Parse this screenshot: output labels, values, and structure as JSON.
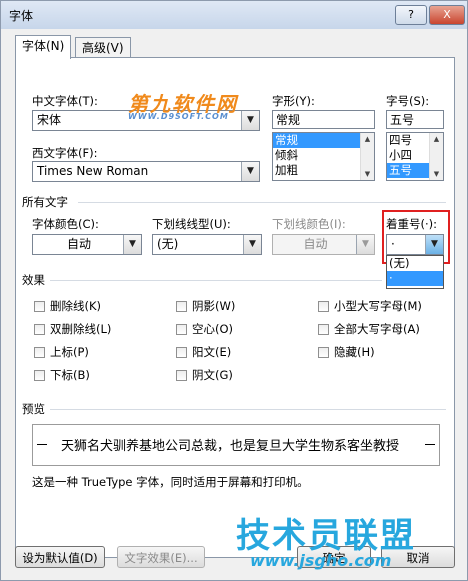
{
  "window": {
    "title": "字体",
    "help_button": "?",
    "close_button": "X"
  },
  "tabs": [
    {
      "label": "字体(N)",
      "active": true
    },
    {
      "label": "高级(V)",
      "active": false
    }
  ],
  "chinese_font": {
    "label": "中文字体(T):",
    "value": "宋体"
  },
  "western_font": {
    "label": "西文字体(F):",
    "value": "Times New Roman"
  },
  "style": {
    "label": "字形(Y):",
    "value": "常规",
    "options": [
      "常规",
      "倾斜",
      "加粗"
    ],
    "selected": 0
  },
  "size": {
    "label": "字号(S):",
    "value": "五号",
    "options": [
      "四号",
      "小四",
      "五号"
    ],
    "selected": 2
  },
  "all_text": {
    "section_label": "所有文字",
    "font_color": {
      "label": "字体颜色(C):",
      "value": "自动"
    },
    "underline_style": {
      "label": "下划线线型(U):",
      "value": "(无)"
    },
    "underline_color": {
      "label": "下划线颜色(I):",
      "value": "自动"
    },
    "emphasis_mark": {
      "label": "着重号(·):",
      "value": "·",
      "options": [
        "(无)",
        "·"
      ],
      "selected": 1
    }
  },
  "effects": {
    "section_label": "效果",
    "col1": [
      "删除线(K)",
      "双删除线(L)",
      "上标(P)",
      "下标(B)"
    ],
    "col2": [
      "阴影(W)",
      "空心(O)",
      "阳文(E)",
      "阴文(G)"
    ],
    "col3": [
      "小型大写字母(M)",
      "全部大写字母(A)",
      "隐藏(H)"
    ]
  },
  "preview": {
    "section_label": "预览",
    "sample_text": "天狮名犬驯养基地公司总裁，也是复旦大学生物系客坐教授",
    "note": "这是一种 TrueType 字体，同时适用于屏幕和打印机。"
  },
  "buttons": {
    "set_default": "设为默认值(D)",
    "text_effects": "文字效果(E)...",
    "ok": "确定",
    "cancel": "取消"
  },
  "watermarks": {
    "top": "第九软件网",
    "top_url": "WWW.D9SOFT.COM",
    "bottom": "技术员联盟",
    "bottom_url": "www.jsgho.com"
  },
  "colors": {
    "title_bar": "#c7d6ea",
    "selection": "#3399ff",
    "highlight_border": "#e02020"
  }
}
